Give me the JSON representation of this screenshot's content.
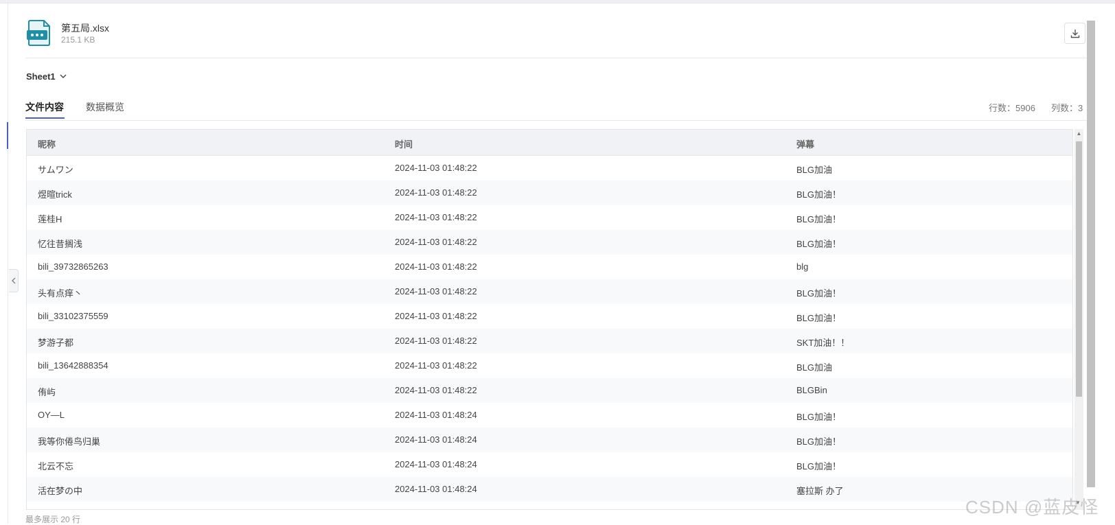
{
  "file": {
    "icon": "spreadsheet-file-icon",
    "name": "第五局.xlsx",
    "size": "215.1 KB",
    "download_icon": "download-icon"
  },
  "sheet": {
    "selected": "Sheet1",
    "chevron_icon": "chevron-down-icon"
  },
  "tabs": [
    {
      "label": "文件内容",
      "active": true
    },
    {
      "label": "数据概览",
      "active": false
    }
  ],
  "counts": {
    "rows": "行数：5906",
    "cols": "列数：3"
  },
  "table": {
    "columns": [
      "昵称",
      "时间",
      "弹幕"
    ],
    "rows": [
      [
        "サムワン",
        "2024-11-03 01:48:22",
        "BLG加油"
      ],
      [
        "煜暄trick",
        "2024-11-03 01:48:22",
        "BLG加油！"
      ],
      [
        "莲桂H",
        "2024-11-03 01:48:22",
        "BLG加油！"
      ],
      [
        "忆往昔搁浅",
        "2024-11-03 01:48:22",
        "BLG加油！"
      ],
      [
        "bili_39732865263",
        "2024-11-03 01:48:22",
        "blg"
      ],
      [
        "头有点痒丶",
        "2024-11-03 01:48:22",
        "BLG加油！"
      ],
      [
        "bili_33102375559",
        "2024-11-03 01:48:22",
        "BLG加油！"
      ],
      [
        "梦游子都",
        "2024-11-03 01:48:22",
        "SKT加油！！"
      ],
      [
        "bili_13642888354",
        "2024-11-03 01:48:22",
        "BLG加油"
      ],
      [
        "侑屿",
        "2024-11-03 01:48:22",
        "BLGBin"
      ],
      [
        "OY—L",
        "2024-11-03 01:48:24",
        "BLG加油！"
      ],
      [
        "我等你倦鸟归巢",
        "2024-11-03 01:48:24",
        "BLG加油！"
      ],
      [
        "北云不忘",
        "2024-11-03 01:48:24",
        "BLG加油！"
      ],
      [
        "活在梦の中",
        "2024-11-03 01:48:24",
        "塞拉斯 办了"
      ]
    ]
  },
  "footer_note": "最多展示 20 行",
  "watermark": "CSDN @蓝皮怪",
  "colors": {
    "accent": "#4a5fc1",
    "icon_teal": "#1f8fa8",
    "header_bg": "#f0f2f5"
  }
}
